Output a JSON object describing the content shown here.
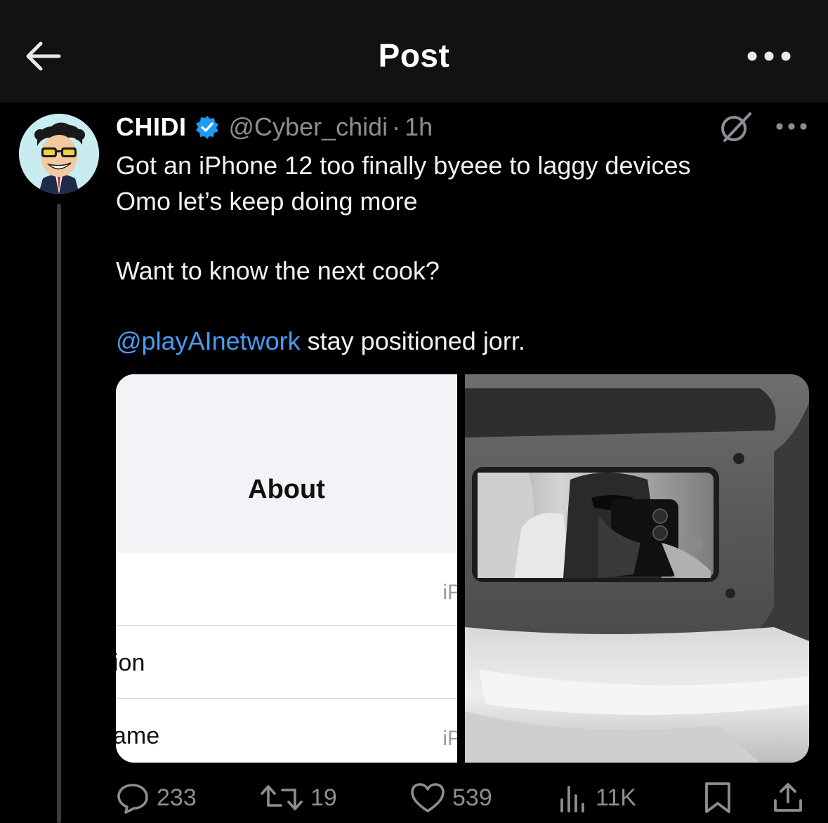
{
  "header": {
    "title": "Post",
    "back_icon": "arrow-left-icon",
    "more_icon": "ellipsis-icon"
  },
  "post": {
    "display_name": "CHIDI",
    "verified": true,
    "handle": "@Cyber_chidi",
    "separator": "·",
    "time": "1h",
    "text_lines": [
      "Got an iPhone 12 too finally byeee to laggy devices",
      "Omo let’s keep doing more"
    ],
    "question": "Want to know the next cook?",
    "mention": "@playAInetwork",
    "mention_rest": " stay positioned jorr."
  },
  "media": {
    "left_screenshot": {
      "title": "About",
      "rows": [
        {
          "label": "",
          "value": "iP"
        },
        {
          "label": "ion",
          "value": ""
        },
        {
          "label": "ame",
          "value": "iP"
        }
      ]
    },
    "right_photo": "black-and-white mirror selfie in car visor mirror"
  },
  "actions": {
    "replies": "233",
    "reposts": "19",
    "likes": "539",
    "views": "11K"
  },
  "colors": {
    "background": "#000000",
    "header_bg": "#121212",
    "link": "#4a9bf0",
    "verified": "#1d9bf0",
    "muted": "#8b8f94"
  }
}
